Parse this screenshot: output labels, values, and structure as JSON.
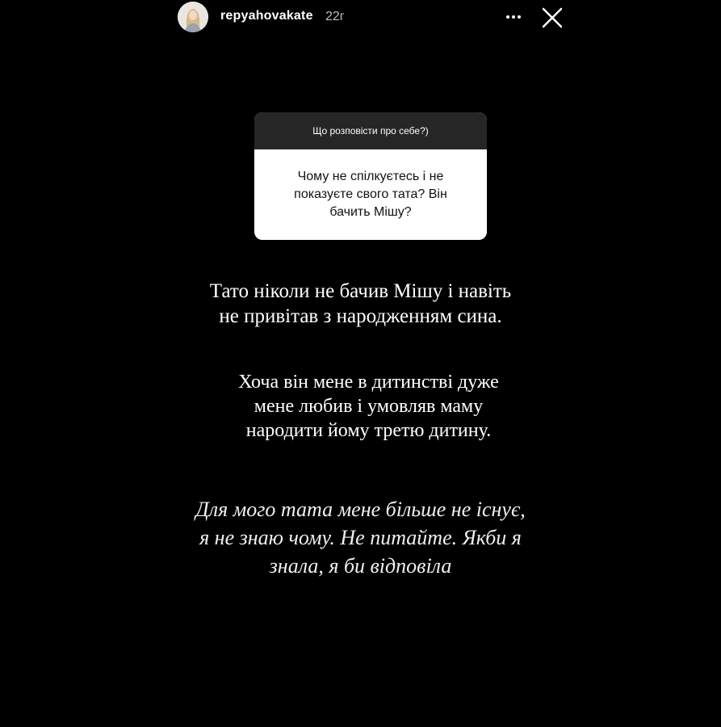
{
  "header": {
    "username": "repyahovakate",
    "timestamp": "22г"
  },
  "question_sticker": {
    "prompt": "Що розповісти про себе?)",
    "question_lines": [
      "Чому не спілкуєтесь і не",
      "показуєте свого тата? Він",
      "бачить Мішу?"
    ]
  },
  "story_text": {
    "block1": [
      "Тато ніколи не бачив Мішу і навіть",
      "не привітав з народженням сина."
    ],
    "block2": [
      "Хоча він мене в дитинстві дуже",
      "мене любив і умовляв маму",
      "народити йому третю дитину."
    ],
    "block3": [
      "Для мого тата мене більше не існує,",
      "я не знаю чому. Не питайте. Якби я",
      "знала, я би відповіла"
    ]
  },
  "icons": {
    "more": "more-dots-icon",
    "close": "close-icon"
  },
  "colors": {
    "background": "#000000",
    "sticker_header": "#262626",
    "sticker_body": "#ffffff"
  }
}
